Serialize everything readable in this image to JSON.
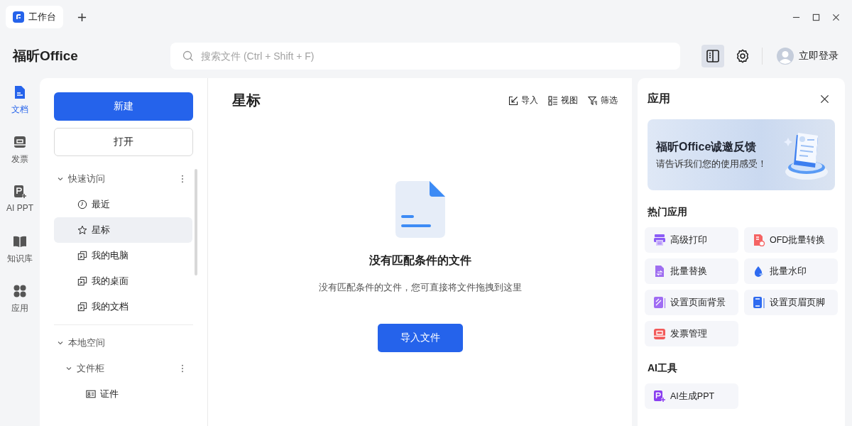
{
  "tabs": [
    {
      "label": "工作台",
      "selected": true
    }
  ],
  "app_name": "福昕Office",
  "search": {
    "placeholder": "搜索文件 (Ctrl + Shift + F)"
  },
  "panel_toggle": {
    "selected": true
  },
  "login": "立即登录",
  "rail": [
    {
      "label": "文档",
      "kind": "doc",
      "selected": true
    },
    {
      "label": "发票",
      "kind": "invoice",
      "selected": false
    },
    {
      "label": "AI PPT",
      "kind": "ppt",
      "selected": false
    },
    {
      "label": "知识库",
      "kind": "book",
      "selected": false
    },
    {
      "label": "应用",
      "kind": "apps",
      "selected": false
    }
  ],
  "sidebar": {
    "buttons": [
      {
        "label": "新建",
        "kind": "primary"
      },
      {
        "label": "打开",
        "kind": "secondary"
      }
    ],
    "tree": [
      {
        "label": "快速访问",
        "kind": "section",
        "menu": true,
        "expanded": true,
        "selected": false,
        "children": [
          {
            "label": "最近",
            "kind": "recent",
            "selected": false
          },
          {
            "label": "星标",
            "kind": "star",
            "selected": true
          },
          {
            "label": "我的电脑",
            "kind": "location",
            "selected": false
          },
          {
            "label": "我的桌面",
            "kind": "location",
            "selected": false
          },
          {
            "label": "我的文档",
            "kind": "location",
            "selected": false
          }
        ]
      },
      {
        "label": "本地空间",
        "kind": "section",
        "menu": false,
        "expanded": true,
        "selected": false,
        "children": [
          {
            "label": "文件柜",
            "kind": "folder",
            "menu": true,
            "expanded": true,
            "selected": false,
            "children": [
              {
                "label": "证件",
                "kind": "card",
                "selected": false
              }
            ]
          }
        ]
      }
    ]
  },
  "main": {
    "title": "星标",
    "actions": [
      {
        "label": "导入",
        "kind": "import"
      },
      {
        "label": "视图",
        "kind": "view"
      },
      {
        "label": "筛选",
        "kind": "filter"
      }
    ],
    "empty": {
      "title": "没有匹配条件的文件",
      "message": "没有匹配条件的文件，您可直接将文件拖拽到这里",
      "button": "导入文件"
    }
  },
  "apps_panel": {
    "title": "应用",
    "banner": {
      "title": "福昕Office诚邀反馈",
      "subtitle": "请告诉我们您的使用感受！"
    },
    "sections": [
      {
        "title": "热门应用",
        "items": [
          {
            "label": "高级打印",
            "kind": "print"
          },
          {
            "label": "OFD批量转换",
            "kind": "ofd"
          },
          {
            "label": "批量替换",
            "kind": "replace"
          },
          {
            "label": "批量水印",
            "kind": "watermark"
          },
          {
            "label": "设置页面背景",
            "kind": "background"
          },
          {
            "label": "设置页眉页脚",
            "kind": "header"
          },
          {
            "label": "发票管理",
            "kind": "invoice"
          }
        ]
      },
      {
        "title": "AI工具",
        "items": [
          {
            "label": "AI生成PPT",
            "kind": "ppt"
          }
        ]
      }
    ]
  }
}
